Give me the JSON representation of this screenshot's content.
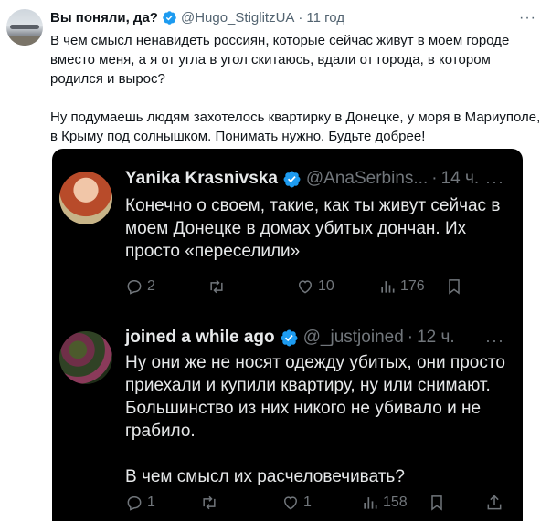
{
  "tweet": {
    "author_name": "Вы поняли, да?",
    "handle": "@Hugo_StiglitzUA",
    "separator": "·",
    "time": "11 год",
    "more": "···",
    "paragraphs": [
      "В чем смысл ненавидеть россиян, которые сейчас живут в моем городе вместо меня, а я от угла в угол скитаюсь, вдали от города, в котором родился и вырос?",
      "Ну подумаешь людям захотелось квартирку в Донецке, у моря в Мариуполе, в Крыму под солнышком. Понимать нужно. Будьте добрее!"
    ]
  },
  "embedded": {
    "replies": [
      {
        "name": "Yanika Krasnivska",
        "handle": "@AnaSerbins...",
        "separator": "·",
        "time": "14 ч.",
        "more": "···",
        "paragraphs": [
          "Конечно о своем, такие, как ты живут сейчас в моем Донецке в домах убитых дончан. Их просто «переселили»"
        ],
        "replies": "2",
        "retweets": "",
        "likes": "10",
        "views": "176"
      },
      {
        "name": "joined a while ago",
        "handle": "@_justjoined",
        "separator": "·",
        "time": "12 ч.",
        "more": "···",
        "paragraphs": [
          "Ну они же не носят одежду убитых, они просто приехали и купили квартиру, ну или снимают. Большинство из них никого не убивало и не грабило.",
          "В чем смысл их расчеловечивать?"
        ],
        "replies": "1",
        "retweets": "",
        "likes": "1",
        "views": "158"
      }
    ]
  },
  "colors": {
    "verified": "#1d9bf0",
    "muted_light": "#536471",
    "muted_dark": "#71767b",
    "embed_bg": "#000000"
  }
}
